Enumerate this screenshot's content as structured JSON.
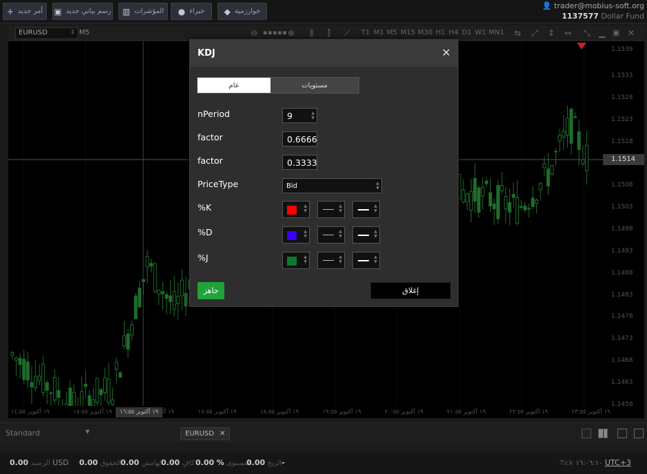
{
  "toolbar": {
    "new_order": "أمر جديد",
    "new_chart": "رسم بياني جديد",
    "indicators": "المؤشرات",
    "experts": "خبراء",
    "algorithms": "خوارزمية"
  },
  "account": {
    "email": "trader@mobius-soft.org",
    "number": "1137577",
    "fund": "Dollar Fund"
  },
  "chart_toolbar": {
    "symbol": "EURUSD",
    "current_tf": "M5",
    "timeframes": [
      "T1",
      "M1",
      "M5",
      "M15",
      "M30",
      "H1",
      "H4",
      "D1",
      "W1",
      "MN1"
    ]
  },
  "price_axis": {
    "labels": [
      "1.1539",
      "1.1533",
      "1.1528",
      "1.1523",
      "1.1518",
      "1.1508",
      "1.1503",
      "1.1498",
      "1.1493",
      "1.1488",
      "1.1483",
      "1.1478",
      "1.1473",
      "1.1468",
      "1.1463",
      "1.1458"
    ],
    "current_price": "1.1514"
  },
  "time_axis": {
    "labels": [
      "١٩ أكتوبر ١٤:٥٥",
      "١٩ أكتوبر ١٥:٥٥",
      "١٩ أكتوبر ١٦:٥٥",
      "١٩ أكتوبر ١٧:٥٥",
      "١٩ أكتوبر ١٨:٥٥",
      "١٩ أكتوبر ١٩:٥٥",
      "١٩ أكتوبر ٢٠:٥٥",
      "١٩ أكتوبر ٢١:٥٥",
      "١٩ أكتوبر ٢٢:٥٥",
      "١٩ أكتوبر ٢٣:٥٥"
    ],
    "cursor_time": "١٩ أكتوبر ١٦:٥٥"
  },
  "bottom": {
    "layout_name": "Standard",
    "symbol_tab": "EURUSD"
  },
  "status": {
    "balance_value": "0.00",
    "balance_label": "الرصيد",
    "currency": "USD",
    "equity_value": "0.00",
    "equity_label": "الحقوق",
    "margin_value": "0.00",
    "margin_label": "الهامش",
    "free_value": "0.00",
    "free_label": "كافٍ",
    "level_value": "%",
    "level_label": "المستوى",
    "pl_value": "0.00-",
    "pl_label": "الربح",
    "tick_label": "Tick",
    "time": "١٦:٠٦:١٠",
    "utc": "UTC+3"
  },
  "dialog": {
    "title": "KDJ",
    "tab_general": "عام",
    "tab_levels": "مستويات",
    "params": [
      {
        "label": "nPeriod",
        "value": "9"
      },
      {
        "label": "factor",
        "value": "0.6666"
      },
      {
        "label": "factor",
        "value": "0.3333"
      }
    ],
    "price_type_label": "PriceType",
    "price_type_value": "Bid",
    "lines": [
      {
        "label": "%K",
        "color": "#ff0000"
      },
      {
        "label": "%D",
        "color": "#3a00ff"
      },
      {
        "label": "%J",
        "color": "#0d7a2a"
      }
    ],
    "ready_button": "جاهز",
    "close_button": "إغلاق"
  },
  "chart_data": {
    "type": "candlestick",
    "symbol": "EURUSD",
    "timeframe": "M5",
    "ylim": [
      1.1455,
      1.1541
    ],
    "last_price": 1.1514
  }
}
